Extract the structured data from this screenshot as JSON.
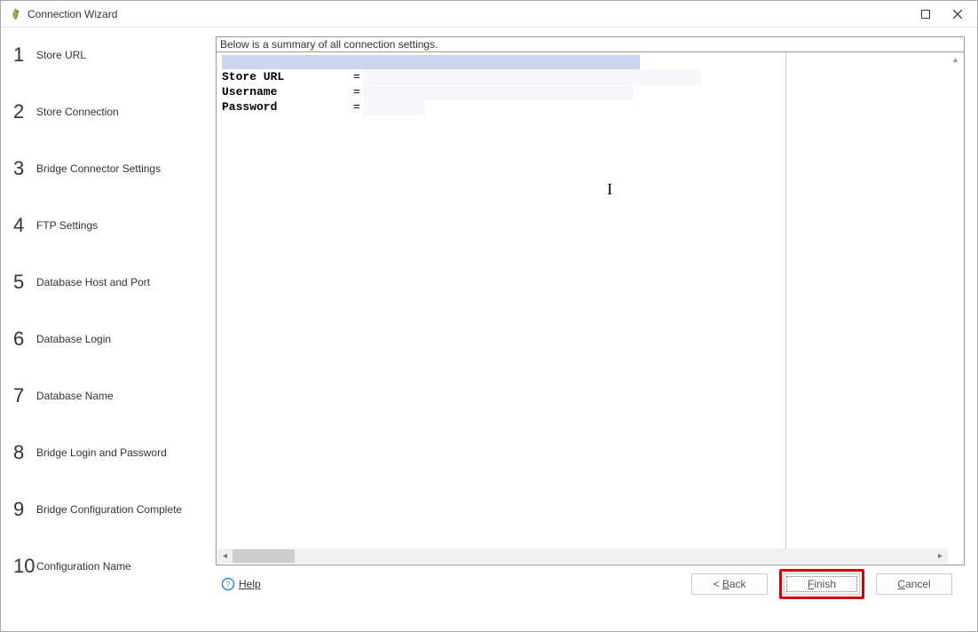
{
  "title": "Connection Wizard",
  "steps": [
    {
      "num": "1",
      "label": "Store URL"
    },
    {
      "num": "2",
      "label": "Store Connection"
    },
    {
      "num": "3",
      "label": "Bridge Connector Settings"
    },
    {
      "num": "4",
      "label": "FTP Settings"
    },
    {
      "num": "5",
      "label": "Database Host and Port"
    },
    {
      "num": "6",
      "label": "Database Login"
    },
    {
      "num": "7",
      "label": "Database Name"
    },
    {
      "num": "8",
      "label": "Bridge Login and Password"
    },
    {
      "num": "9",
      "label": "Bridge Configuration Complete"
    },
    {
      "num": "10",
      "label": "Configuration Name"
    }
  ],
  "summary": {
    "header": "Below is a summary of all connection settings.",
    "rows": [
      {
        "key": "Store URL",
        "eq": "=",
        "val": ""
      },
      {
        "key": "Username",
        "eq": "=",
        "val": ""
      },
      {
        "key": "Password",
        "eq": "=",
        "val": ""
      }
    ]
  },
  "footer": {
    "help": "Help",
    "back": "Back",
    "back_prefix": "< ",
    "finish": "Finish",
    "cancel": "Cancel"
  }
}
